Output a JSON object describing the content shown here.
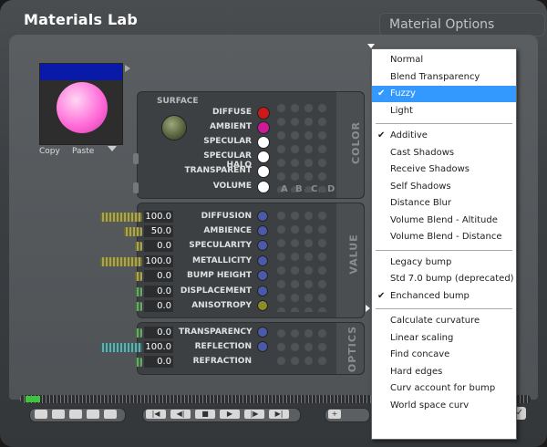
{
  "window": {
    "title": "Materials Lab",
    "options_button": "Material Options"
  },
  "preview": {
    "copy_label": "Copy",
    "paste_label": "Paste"
  },
  "surface": {
    "label": "SURFACE",
    "side_label": "COLOR",
    "columns": [
      "A",
      "B",
      "C",
      "D"
    ],
    "rows": [
      {
        "label": "DIFFUSE",
        "swatch": "#cc1a1a"
      },
      {
        "label": "AMBIENT",
        "swatch": "#cc1a99"
      },
      {
        "label": "SPECULAR",
        "swatch": "#ffffff"
      },
      {
        "label": "SPECULAR HALO",
        "swatch": "#ffffff"
      },
      {
        "label": "TRANSPARENT",
        "swatch": "#ffffff"
      },
      {
        "label": "VOLUME",
        "swatch": "#ffffff"
      }
    ]
  },
  "value": {
    "side_label": "VALUE",
    "rows": [
      {
        "value": "100.0",
        "label": "DIFFUSION"
      },
      {
        "value": "50.0",
        "label": "AMBIENCE"
      },
      {
        "value": "0.0",
        "label": "SPECULARITY"
      },
      {
        "value": "100.0",
        "label": "METALLICITY"
      },
      {
        "value": "0.0",
        "label": "BUMP HEIGHT"
      },
      {
        "value": "0.0",
        "label": "DISPLACEMENT"
      },
      {
        "value": "0.0",
        "label": "ANISOTROPY"
      }
    ]
  },
  "optics": {
    "side_label": "OPTICS",
    "rows": [
      {
        "value": "0.0",
        "label": "TRANSPARENCY"
      },
      {
        "value": "100.0",
        "label": "REFLECTION"
      },
      {
        "value": "0.0",
        "label": "REFRACTION"
      }
    ]
  },
  "menu": {
    "groups": [
      [
        {
          "label": "Normal",
          "checked": false,
          "selected": false
        },
        {
          "label": "Blend Transparency",
          "checked": false,
          "selected": false
        },
        {
          "label": "Fuzzy",
          "checked": true,
          "selected": true
        },
        {
          "label": "Light",
          "checked": false,
          "selected": false
        }
      ],
      [
        {
          "label": "Additive",
          "checked": true,
          "selected": false
        },
        {
          "label": "Cast Shadows",
          "checked": false,
          "selected": false
        },
        {
          "label": "Receive Shadows",
          "checked": false,
          "selected": false
        },
        {
          "label": "Self Shadows",
          "checked": false,
          "selected": false
        },
        {
          "label": "Distance Blur",
          "checked": false,
          "selected": false
        },
        {
          "label": "Volume Blend - Altitude",
          "checked": false,
          "selected": false
        },
        {
          "label": "Volume Blend - Distance",
          "checked": false,
          "selected": false
        }
      ],
      [
        {
          "label": "Legacy bump",
          "checked": false,
          "selected": false
        },
        {
          "label": "Std 7.0 bump (deprecated)",
          "checked": false,
          "selected": false
        },
        {
          "label": "Enchanced bump",
          "checked": true,
          "selected": false
        }
      ],
      [
        {
          "label": "Calculate curvature",
          "checked": false,
          "selected": false
        },
        {
          "label": "Linear scaling",
          "checked": false,
          "selected": false
        },
        {
          "label": "Find concave",
          "checked": false,
          "selected": false
        },
        {
          "label": "Hard edges",
          "checked": false,
          "selected": false
        },
        {
          "label": "Curv account for bump",
          "checked": false,
          "selected": false
        },
        {
          "label": "World space curv",
          "checked": false,
          "selected": false
        }
      ]
    ]
  },
  "playback": {
    "buttons": [
      "|◀",
      "◀|",
      "■",
      "▶",
      "|▶",
      "▶|"
    ],
    "plus": "+"
  }
}
